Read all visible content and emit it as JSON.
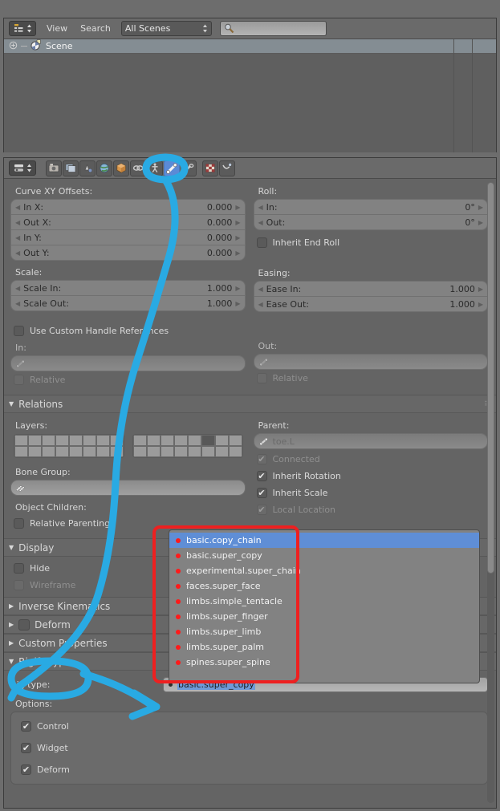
{
  "app": {
    "name": "Blender",
    "theme_accent": "#5b8ad6",
    "annotation_color": "#29aae3",
    "highlight_color": "#ee2020"
  },
  "outliner": {
    "editor_type_icon": "outliner-icon",
    "menus": [
      {
        "name": "view-menu",
        "label": "View"
      },
      {
        "name": "search-menu",
        "label": "Search"
      }
    ],
    "display_mode": {
      "label": "All Scenes",
      "icon": "chevron-updown-icon"
    },
    "search": {
      "placeholder": "",
      "value": "",
      "icon": "search-icon"
    },
    "rows": [
      {
        "expander": "plus-icon",
        "icon": "scene-icon",
        "label": "Scene",
        "selected": true
      }
    ]
  },
  "properties": {
    "editor_type_icon": "properties-icon",
    "tabs": [
      {
        "name": "render-tab",
        "icon": "camera-back-icon",
        "active": false
      },
      {
        "name": "render-layers-tab",
        "icon": "images-icon",
        "active": false
      },
      {
        "name": "scene-tab",
        "icon": "scene-cone-icon",
        "active": false
      },
      {
        "name": "world-tab",
        "icon": "world-icon",
        "active": false
      },
      {
        "name": "object-tab",
        "icon": "cube-icon",
        "active": false
      },
      {
        "name": "constraints-tab",
        "icon": "chain-icon",
        "active": false
      },
      {
        "name": "armature-data-tab",
        "icon": "armature-icon",
        "active": false
      },
      {
        "name": "bone-tab",
        "icon": "bone-icon",
        "active": true
      },
      {
        "name": "bone-constraint-tab",
        "icon": "bone-constraint-icon",
        "active": false
      },
      {
        "name": "texture-tab",
        "icon": "checker-icon",
        "active": false
      },
      {
        "name": "physics-tab",
        "icon": "physics-icon",
        "active": false
      }
    ],
    "bbone": {
      "curve_group_label": "Curve XY Offsets:",
      "curve_fields": [
        {
          "label": "In X:",
          "value": "0.000"
        },
        {
          "label": "Out X:",
          "value": "0.000"
        },
        {
          "label": "In Y:",
          "value": "0.000"
        },
        {
          "label": "Out Y:",
          "value": "0.000"
        }
      ],
      "scale_group_label": "Scale:",
      "scale_fields": [
        {
          "label": "Scale In:",
          "value": "1.000"
        },
        {
          "label": "Scale Out:",
          "value": "1.000"
        }
      ],
      "roll_group_label": "Roll:",
      "roll_fields": [
        {
          "label": "In:",
          "value": "0°"
        },
        {
          "label": "Out:",
          "value": "0°"
        }
      ],
      "inherit_end_roll": {
        "label": "Inherit End Roll",
        "checked": false
      },
      "easing_group_label": "Easing:",
      "easing_fields": [
        {
          "label": "Ease In:",
          "value": "1.000"
        },
        {
          "label": "Ease Out:",
          "value": "1.000"
        }
      ],
      "use_custom_handle_refs": {
        "label": "Use Custom Handle References",
        "checked": false
      },
      "handle_in_label": "In:",
      "handle_in_value": "",
      "handle_in_relative": {
        "label": "Relative",
        "checked": false,
        "enabled": false
      },
      "handle_out_label": "Out:",
      "handle_out_value": "",
      "handle_out_relative": {
        "label": "Relative",
        "checked": false,
        "enabled": false
      }
    },
    "relations": {
      "title": "Relations",
      "layers_label": "Layers:",
      "layers_group_a": [
        [
          false,
          false,
          false,
          false,
          false,
          false,
          false,
          false
        ],
        [
          false,
          false,
          false,
          false,
          false,
          false,
          false,
          false
        ]
      ],
      "layers_group_b": [
        [
          false,
          false,
          false,
          false,
          false,
          true,
          false,
          false
        ],
        [
          false,
          false,
          false,
          false,
          false,
          false,
          false,
          false
        ]
      ],
      "bone_group_label": "Bone Group:",
      "bone_group_value": "",
      "object_children_label": "Object Children:",
      "relative_parenting": {
        "label": "Relative Parenting",
        "checked": false
      },
      "parent_label": "Parent:",
      "parent_value": "toe.L",
      "connected": {
        "label": "Connected",
        "checked": true,
        "enabled": false
      },
      "inherit_rotation": {
        "label": "Inherit Rotation",
        "checked": true,
        "enabled": true
      },
      "inherit_scale": {
        "label": "Inherit Scale",
        "checked": true,
        "enabled": true
      },
      "local_location": {
        "label": "Local Location",
        "checked": true,
        "enabled": false
      }
    },
    "panels": [
      {
        "name": "display-panel",
        "title": "Display",
        "open": true
      },
      {
        "name": "inverse-kinematics-panel",
        "title": "Inverse Kinematics",
        "open": false
      },
      {
        "name": "deform-panel",
        "title": "Deform",
        "open": false,
        "has_checkbox": true
      },
      {
        "name": "custom-properties-panel",
        "title": "Custom Properties",
        "open": false
      },
      {
        "name": "rigify-type-panel",
        "title": "Rigify Type",
        "open": true
      }
    ],
    "display": {
      "hide": {
        "label": "Hide",
        "checked": false
      },
      "wireframe": {
        "label": "Wireframe",
        "checked": false,
        "enabled": false
      }
    },
    "rigify": {
      "rig_type_label": "Rig type:",
      "rig_type_value": "basic.super_copy",
      "options_label": "Options:",
      "options": [
        {
          "label": "Control",
          "checked": true
        },
        {
          "label": "Widget",
          "checked": true
        },
        {
          "label": "Deform",
          "checked": true
        }
      ]
    }
  },
  "rig_type_dropdown": {
    "open": true,
    "items": [
      {
        "label": "basic.copy_chain",
        "selected": true
      },
      {
        "label": "basic.super_copy",
        "selected": false
      },
      {
        "label": "experimental.super_chain",
        "selected": false
      },
      {
        "label": "faces.super_face",
        "selected": false
      },
      {
        "label": "limbs.simple_tentacle",
        "selected": false
      },
      {
        "label": "limbs.super_finger",
        "selected": false
      },
      {
        "label": "limbs.super_limb",
        "selected": false
      },
      {
        "label": "limbs.super_palm",
        "selected": false
      },
      {
        "label": "spines.super_spine",
        "selected": false
      }
    ]
  },
  "annotations": {
    "red_box": {
      "name": "rig-type-list-highlight"
    },
    "blue_marks": [
      {
        "name": "annotation-circle-bone-tab"
      },
      {
        "name": "annotation-curve-to-rigify"
      },
      {
        "name": "annotation-circle-rigify-type"
      },
      {
        "name": "annotation-arrow-to-rig-type-field"
      }
    ]
  }
}
